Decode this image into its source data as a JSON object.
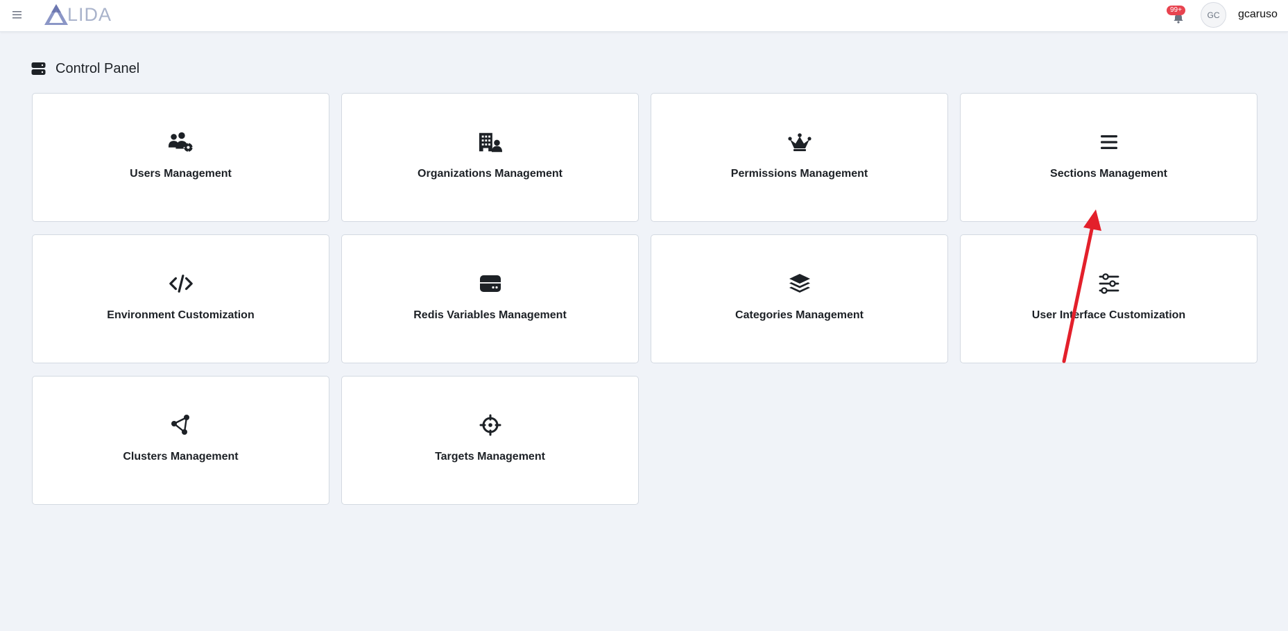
{
  "header": {
    "logo_text": "LIDA",
    "notification_badge": "99+",
    "avatar_initials": "GC",
    "username": "gcaruso"
  },
  "page": {
    "title": "Control Panel"
  },
  "cards": [
    {
      "label": "Users Management",
      "icon": "users-gear-icon"
    },
    {
      "label": "Organizations Management",
      "icon": "building-user-icon"
    },
    {
      "label": "Permissions Management",
      "icon": "crown-icon"
    },
    {
      "label": "Sections Management",
      "icon": "bars-icon"
    },
    {
      "label": "Environment Customization",
      "icon": "code-icon"
    },
    {
      "label": "Redis Variables Management",
      "icon": "hard-drive-icon"
    },
    {
      "label": "Categories Management",
      "icon": "layer-group-icon"
    },
    {
      "label": "User Interface Customization",
      "icon": "sliders-icon"
    },
    {
      "label": "Clusters Management",
      "icon": "circle-nodes-icon"
    },
    {
      "label": "Targets Management",
      "icon": "crosshairs-icon"
    }
  ],
  "colors": {
    "background": "#f0f3f8",
    "card_border": "#d3d9e1",
    "badge": "#e8434f",
    "annotation_arrow": "#e3202b",
    "logo": "#7c87b8"
  }
}
